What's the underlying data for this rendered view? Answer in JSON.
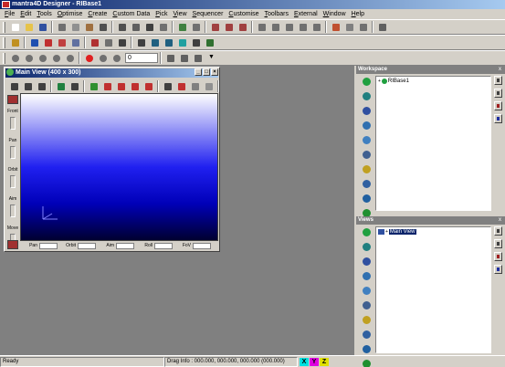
{
  "window": {
    "title": "mantra4D Designer - RIBase1"
  },
  "menu": [
    "File",
    "Edit",
    "Tools",
    "Optimise",
    "Create",
    "Custom Data",
    "Pick",
    "View",
    "Sequencer",
    "Customise",
    "Toolbars",
    "External",
    "Window",
    "Help"
  ],
  "toolbar": {
    "frame_value": "0",
    "row1_icons": [
      {
        "name": "new-icon",
        "color": "#ffffff"
      },
      {
        "name": "open-icon",
        "color": "#e6c34a"
      },
      {
        "name": "save-icon",
        "color": "#3050a0"
      },
      {
        "name": "cut-icon",
        "color": "#707070"
      },
      {
        "name": "copy-icon",
        "color": "#909090"
      },
      {
        "name": "paste-icon",
        "color": "#a07040"
      },
      {
        "name": "undo-icon",
        "color": "#505050"
      },
      {
        "name": "redo-icon",
        "color": "#505050"
      },
      {
        "name": "find-icon",
        "color": "#606060"
      },
      {
        "name": "binoculars-icon",
        "color": "#404040"
      },
      {
        "name": "zoom-icon",
        "color": "#707070"
      },
      {
        "name": "select-icon",
        "color": "#408040"
      },
      {
        "name": "target-icon",
        "color": "#707070"
      },
      {
        "name": "frame-icon",
        "color": "#a04040"
      },
      {
        "name": "frame2-icon",
        "color": "#a04040"
      },
      {
        "name": "frame3-icon",
        "color": "#a04040"
      },
      {
        "name": "move-icon",
        "color": "#707070"
      },
      {
        "name": "rotate-icon",
        "color": "#707070"
      },
      {
        "name": "scale-icon",
        "color": "#707070"
      },
      {
        "name": "align-icon",
        "color": "#707070"
      },
      {
        "name": "snap-icon",
        "color": "#707070"
      },
      {
        "name": "paint-icon",
        "color": "#c05030"
      },
      {
        "name": "light-icon",
        "color": "#808080"
      },
      {
        "name": "camera-icon",
        "color": "#707070"
      },
      {
        "name": "antenna-icon",
        "color": "#606060"
      }
    ],
    "row2_icons": [
      {
        "name": "material-icon",
        "color": "#c09020"
      },
      {
        "name": "cube-icon",
        "color": "#2050b0"
      },
      {
        "name": "sphere-icon",
        "color": "#c03030"
      },
      {
        "name": "particles-icon",
        "color": "#c04040"
      },
      {
        "name": "bones-icon",
        "color": "#6070a0"
      },
      {
        "name": "layers-icon",
        "color": "#b03030"
      },
      {
        "name": "grid-icon",
        "color": "#707070"
      },
      {
        "name": "texture-icon",
        "color": "#404040"
      },
      {
        "name": "link-icon",
        "color": "#404040"
      },
      {
        "name": "car-icon",
        "color": "#206080"
      },
      {
        "name": "vehicle-icon",
        "color": "#206080"
      },
      {
        "name": "scene-icon",
        "color": "#20a0a0"
      },
      {
        "name": "mesh-icon",
        "color": "#404040"
      },
      {
        "name": "export-icon",
        "color": "#307030"
      }
    ],
    "row3_icons": [
      {
        "name": "rewind-icon",
        "color": "#707070"
      },
      {
        "name": "step-back-icon",
        "color": "#707070"
      },
      {
        "name": "play-back-icon",
        "color": "#707070"
      },
      {
        "name": "play-icon",
        "color": "#707070"
      },
      {
        "name": "step-forward-icon",
        "color": "#707070"
      },
      {
        "name": "record-icon",
        "color": "#e02020"
      },
      {
        "name": "loop-icon",
        "color": "#707070"
      },
      {
        "name": "pingpong-icon",
        "color": "#707070"
      }
    ],
    "row3_icons_after": [
      {
        "name": "infinity-icon",
        "color": "#606060"
      },
      {
        "name": "speed-icon",
        "color": "#606060"
      },
      {
        "name": "timer-icon",
        "color": "#606060"
      }
    ]
  },
  "main_view": {
    "title": "Main View (400 x 300)",
    "icons": [
      {
        "name": "cube-front-icon",
        "color": "#404040"
      },
      {
        "name": "cube-side-icon",
        "color": "#404040"
      },
      {
        "name": "cube-top-icon",
        "color": "#404040"
      },
      {
        "name": "shaded-icon",
        "color": "#208040"
      },
      {
        "name": "print-icon",
        "color": "#404040"
      },
      {
        "name": "texture-view-icon",
        "color": "#309030"
      },
      {
        "name": "wire-icon",
        "color": "#c03030"
      },
      {
        "name": "edges-icon",
        "color": "#c03030"
      },
      {
        "name": "bounds-icon",
        "color": "#c03030"
      },
      {
        "name": "normals-icon",
        "color": "#c03030"
      },
      {
        "name": "light-view-icon",
        "color": "#404040"
      },
      {
        "name": "color-icon",
        "color": "#c03030"
      },
      {
        "name": "gray-icon",
        "color": "#808080"
      },
      {
        "name": "gray2-icon",
        "color": "#909090"
      }
    ],
    "side_labels": [
      "Front",
      "Pan",
      "Orbit",
      "Aim",
      "Move"
    ],
    "bottom_labels": [
      "Pan",
      "Orbit",
      "Aim",
      "Roll",
      "FoV"
    ]
  },
  "workspace": {
    "title": "Workspace",
    "tree_root": "RIBase1",
    "close_glyph": "x",
    "icons": [
      {
        "name": "globe-icon",
        "color": "#20a040"
      },
      {
        "name": "shield-icon",
        "color": "#208080"
      },
      {
        "name": "link-chain-icon",
        "color": "#3050a0"
      },
      {
        "name": "trophy-icon",
        "color": "#3070b0"
      },
      {
        "name": "drop-icon",
        "color": "#4080c0"
      },
      {
        "name": "medal-icon",
        "color": "#406090"
      },
      {
        "name": "bulb-icon",
        "color": "#c0a020"
      },
      {
        "name": "pen-icon",
        "color": "#3060a0"
      },
      {
        "name": "car-icon",
        "color": "#2060a0"
      },
      {
        "name": "help-icon",
        "color": "#209030"
      }
    ],
    "right_icons": [
      {
        "name": "list-icon",
        "color": "#404040"
      },
      {
        "name": "clipboard-icon",
        "color": "#404040"
      },
      {
        "name": "trash-icon",
        "color": "#a02020"
      },
      {
        "name": "hourglass-icon",
        "color": "#2030a0"
      }
    ]
  },
  "views": {
    "title": "Views",
    "tree_root": "Main View",
    "close_glyph": "x"
  },
  "status": {
    "ready": "Ready",
    "drag_info": "Drag Info : 000.000, 000.000, 000.000  (000.000)",
    "axes": [
      {
        "label": "X",
        "color": "#00e0e0"
      },
      {
        "label": "Y",
        "color": "#e000e0"
      },
      {
        "label": "Z",
        "color": "#e0e000"
      }
    ]
  }
}
